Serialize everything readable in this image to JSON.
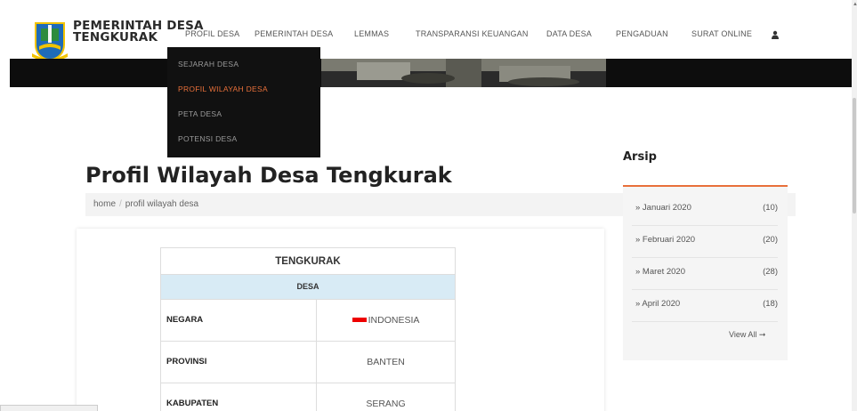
{
  "site": {
    "title_line1": "PEMERINTAH DESA",
    "title_line2": "TENGKURAK"
  },
  "nav": {
    "items": [
      "PROFIL DESA",
      "PEMERINTAH DESA",
      "LEMMAS",
      "TRANSPARANSI KEUANGAN",
      "DATA DESA",
      "PENGADUAN",
      "SURAT ONLINE"
    ],
    "user_icon": "user-icon"
  },
  "dropdown": {
    "items": [
      "SEJARAH DESA",
      "PROFIL WILAYAH DESA",
      "PETA DESA",
      "POTENSI DESA"
    ],
    "active_index": 1
  },
  "page": {
    "title": "Profil Wilayah Desa Tengkurak"
  },
  "breadcrumb": {
    "home": "home",
    "separator": "/",
    "current": "profil wilayah desa"
  },
  "profile_table": {
    "header": "TENGKURAK",
    "subheader": "DESA",
    "rows": [
      {
        "label": "NEGARA",
        "value": "INDONESIA",
        "flag": true
      },
      {
        "label": "PROVINSI",
        "value": "BANTEN"
      },
      {
        "label": "KABUPATEN",
        "value": "SERANG"
      }
    ]
  },
  "arsip": {
    "title": "Arsip",
    "items": [
      {
        "label": "» Januari 2020",
        "count": "(10)"
      },
      {
        "label": "» Februari 2020",
        "count": "(20)"
      },
      {
        "label": "» Maret 2020",
        "count": "(28)"
      },
      {
        "label": "» April 2020",
        "count": "(18)"
      }
    ],
    "view_all": "View All ➞"
  },
  "colors": {
    "accent": "#e8703a",
    "banner": "#0d0d0d",
    "table_sub": "#d8ebf5"
  }
}
